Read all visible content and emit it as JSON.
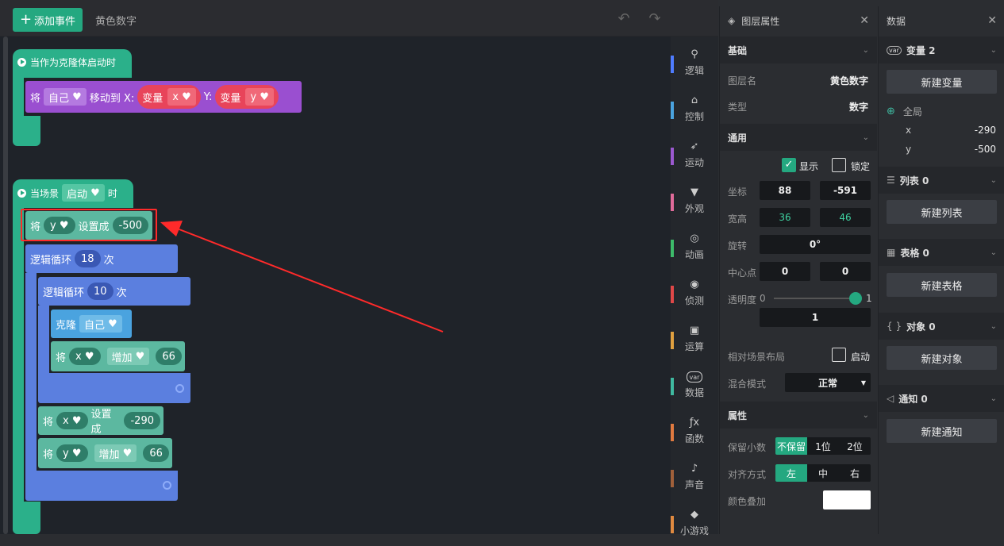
{
  "topbar": {
    "add_event_label": "添加事件",
    "layer_name": "黄色数字"
  },
  "blocks": {
    "hat1": "当作为克隆体启动时",
    "move_prefix": "将",
    "move_target": "自己",
    "move_to_x": "移动到 X:",
    "var_label": "变量",
    "var_x": "x",
    "y_label": "Y:",
    "var_y": "y",
    "hat2_prefix": "当场景",
    "hat2_event": "启动",
    "hat2_suffix": "时",
    "set_prefix": "将",
    "set_var_y": "y",
    "set_to": "设置成",
    "set_y_value": "-500",
    "loop1_label": "逻辑循环",
    "loop1_count": "18",
    "loop_times": "次",
    "loop2_label": "逻辑循环",
    "loop2_count": "10",
    "clone_label": "克隆",
    "clone_target": "自己",
    "inc_prefix": "将",
    "inc_var_x": "x",
    "inc_op": "增加",
    "inc_x_value": "66",
    "setx_var": "x",
    "setx_value": "-290",
    "incy_var": "y",
    "incy_value": "66"
  },
  "categories": [
    {
      "label": "逻辑",
      "icon": "tree-icon",
      "color": "#4f7cff"
    },
    {
      "label": "控制",
      "icon": "control-icon",
      "color": "#4aa3df"
    },
    {
      "label": "运动",
      "icon": "run-icon",
      "color": "#9b59d0"
    },
    {
      "label": "外观",
      "icon": "shirt-icon",
      "color": "#e06b9a"
    },
    {
      "label": "动画",
      "icon": "animation-icon",
      "color": "#3dbb6a"
    },
    {
      "label": "侦测",
      "icon": "sensor-icon",
      "color": "#e04848"
    },
    {
      "label": "运算",
      "icon": "calc-icon",
      "color": "#e0a040"
    },
    {
      "label": "数据",
      "icon": "var-icon",
      "color": "#3fb9a0"
    },
    {
      "label": "函数",
      "icon": "fx-icon",
      "color": "#e07a40"
    },
    {
      "label": "声音",
      "icon": "mic-icon",
      "color": "#a0603a"
    },
    {
      "label": "小游戏",
      "icon": "game-icon",
      "color": "#e08a40"
    }
  ],
  "props": {
    "title": "图层属性",
    "basic": "基础",
    "layer_name_label": "图层名",
    "layer_name_value": "黄色数字",
    "type_label": "类型",
    "type_value": "数字",
    "general": "通用",
    "show_label": "显示",
    "lock_label": "锁定",
    "coord_label": "坐标",
    "coord_x": "88",
    "coord_y": "-591",
    "size_label": "宽高",
    "width": "36",
    "height": "46",
    "rotate_label": "旋转",
    "rotate_value": "0°",
    "center_label": "中心点",
    "center_x": "0",
    "center_y": "0",
    "opacity_label": "透明度",
    "opacity_min": "0",
    "opacity_max": "1",
    "opacity_value": "1",
    "relative_label": "相对场景布局",
    "relative_toggle": "启动",
    "blend_label": "混合模式",
    "blend_value": "正常",
    "attributes": "属性",
    "decimals_label": "保留小数",
    "decimals_options": [
      "不保留",
      "1位",
      "2位"
    ],
    "align_label": "对齐方式",
    "align_options": [
      "左",
      "中",
      "右"
    ],
    "color_overlay_label": "颜色叠加"
  },
  "data_panel": {
    "title": "数据",
    "variables_header": "变量 2",
    "new_variable": "新建变量",
    "global_label": "全局",
    "vars": [
      {
        "name": "x",
        "value": "-290"
      },
      {
        "name": "y",
        "value": "-500"
      }
    ],
    "lists_header": "列表 0",
    "new_list": "新建列表",
    "tables_header": "表格 0",
    "new_table": "新建表格",
    "objects_header": "对象 0",
    "new_object": "新建对象",
    "notices_header": "通知 0",
    "new_notice": "新建通知"
  },
  "colors": {
    "accent": "#24a880",
    "event_block": "#2bb08a",
    "motion_block": "#9a4fd0",
    "loop_block": "#5b7fdf",
    "data_block": "#5cb8a0",
    "highlight": "#ff2a2a"
  }
}
